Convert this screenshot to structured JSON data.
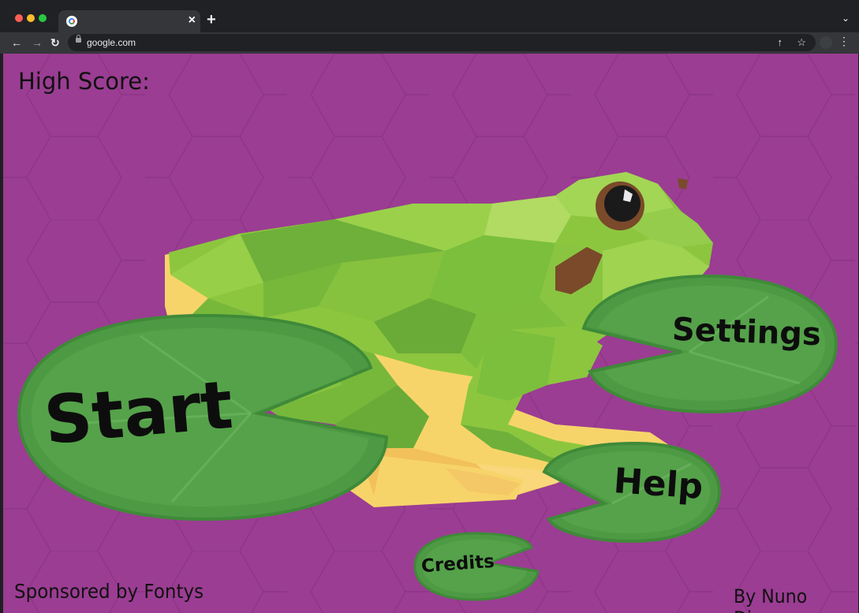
{
  "browser": {
    "tab_title": "",
    "url": "google.com",
    "new_tab": "+",
    "tab_close": "×"
  },
  "game": {
    "high_score_label": "High Score:",
    "buttons": {
      "start": "Start",
      "settings": "Settings",
      "help": "Help",
      "credits": "Credits"
    },
    "sponsor": "Sponsored by Fontys",
    "author": "By Nuno Dias"
  },
  "colors": {
    "background": "#9b3d93",
    "lily_pad": "#4e9a44",
    "frog_green": "#8cc63f",
    "frog_belly": "#f7d46a"
  }
}
